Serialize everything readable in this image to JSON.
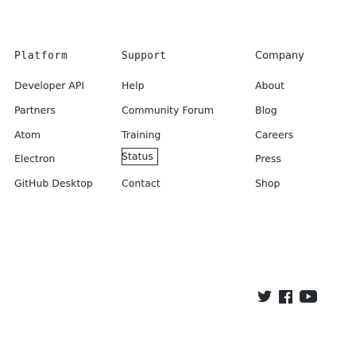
{
  "columns": {
    "platform": {
      "heading": "Platform",
      "links": [
        "Developer API",
        "Partners",
        "Atom",
        "Electron",
        "GitHub Desktop"
      ]
    },
    "support": {
      "heading": "Support",
      "links": [
        "Help",
        "Community Forum",
        "Training",
        "Status",
        "Contact"
      ]
    },
    "company": {
      "heading": "Company",
      "links": [
        "About",
        "Blog",
        "Careers",
        "Press",
        "Shop"
      ]
    }
  },
  "social": {
    "icons": [
      "twitter-icon",
      "facebook-icon",
      "youtube-icon"
    ],
    "color": "#24292e"
  }
}
